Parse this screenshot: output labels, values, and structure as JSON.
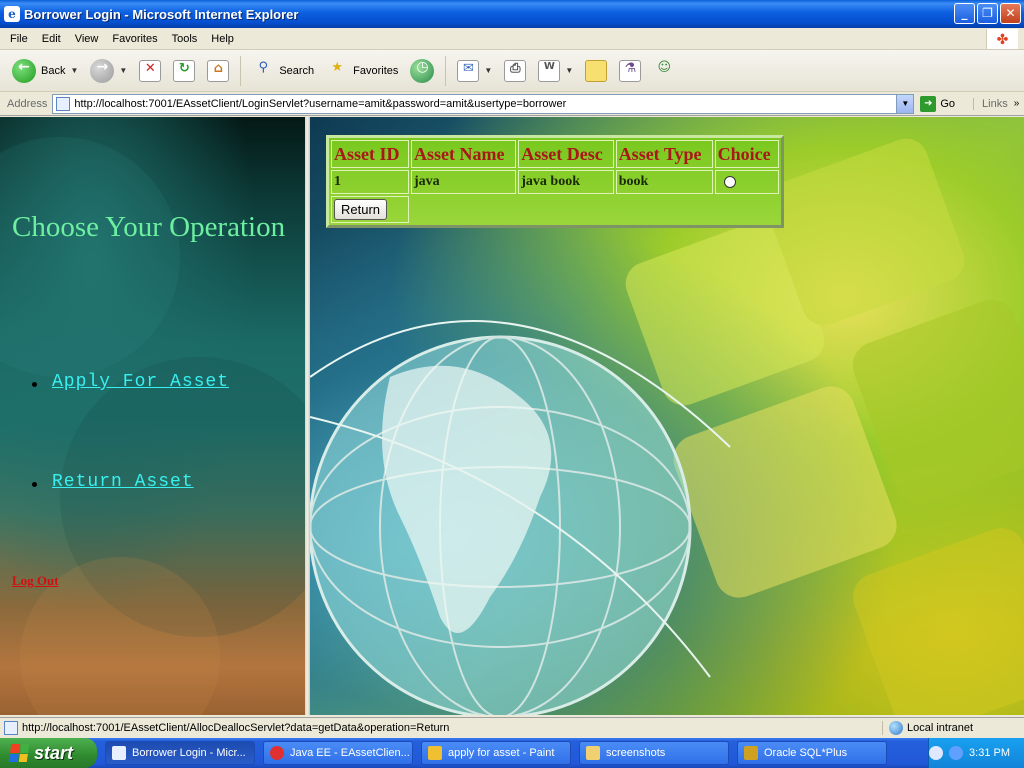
{
  "window": {
    "title": "Borrower Login - Microsoft Internet Explorer",
    "minimize": "_",
    "maximize": "❐",
    "close": "✕"
  },
  "menu": [
    "File",
    "Edit",
    "View",
    "Favorites",
    "Tools",
    "Help"
  ],
  "toolbar": {
    "back": "Back",
    "search": "Search",
    "favorites": "Favorites"
  },
  "address": {
    "label": "Address",
    "url": "http://localhost:7001/EAssetClient/LoginServlet?username=amit&password=amit&usertype=borrower",
    "go": "Go",
    "links": "Links"
  },
  "left_frame": {
    "heading": "Choose Your Operation",
    "menu": [
      "Apply For Asset",
      "Return Asset"
    ],
    "logout": "Log Out"
  },
  "asset_table": {
    "headers": [
      "Asset ID",
      "Asset Name",
      "Asset Desc",
      "Asset Type",
      "Choice"
    ],
    "rows": [
      {
        "id": "1",
        "name": "java",
        "desc": "java book",
        "type": "book"
      }
    ],
    "button": "Return"
  },
  "status": {
    "text": "http://localhost:7001/EAssetClient/AllocDeallocServlet?data=getData&operation=Return",
    "zone": "Local intranet"
  },
  "taskbar": {
    "start": "start",
    "tasks": [
      "Borrower Login - Micr...",
      "Java EE - EAssetClien...",
      "apply for asset - Paint",
      "screenshots",
      "Oracle SQL*Plus"
    ],
    "clock": "3:31 PM"
  }
}
